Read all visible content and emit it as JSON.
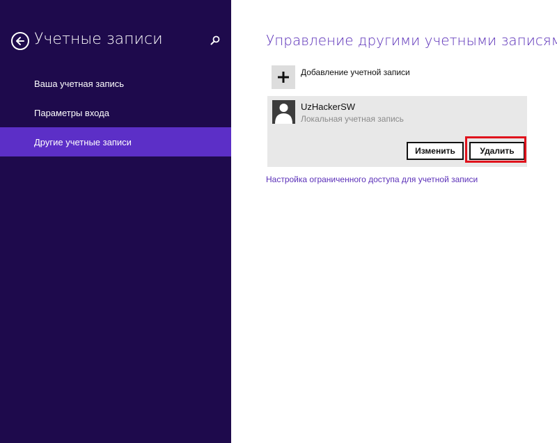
{
  "sidebar": {
    "title": "Учетные записи",
    "items": [
      {
        "label": "Ваша учетная запись",
        "active": false
      },
      {
        "label": "Параметры входа",
        "active": false
      },
      {
        "label": "Другие учетные записи",
        "active": true
      }
    ]
  },
  "main": {
    "title": "Управление другими учетными записями",
    "add_account_label": "Добавление учетной записи",
    "account": {
      "name": "UzHackerSW",
      "type": "Локальная учетная запись",
      "change_label": "Изменить",
      "delete_label": "Удалить"
    },
    "restricted_access_link": "Настройка ограниченного доступа для учетной записи"
  },
  "colors": {
    "sidebar_bg": "#1e0a4c",
    "active_item": "#5c2fc7",
    "accent": "#5a2fb8",
    "highlight": "#e0121c"
  },
  "icons": [
    "back-arrow-icon",
    "search-icon",
    "plus-icon",
    "user-avatar-icon"
  ]
}
